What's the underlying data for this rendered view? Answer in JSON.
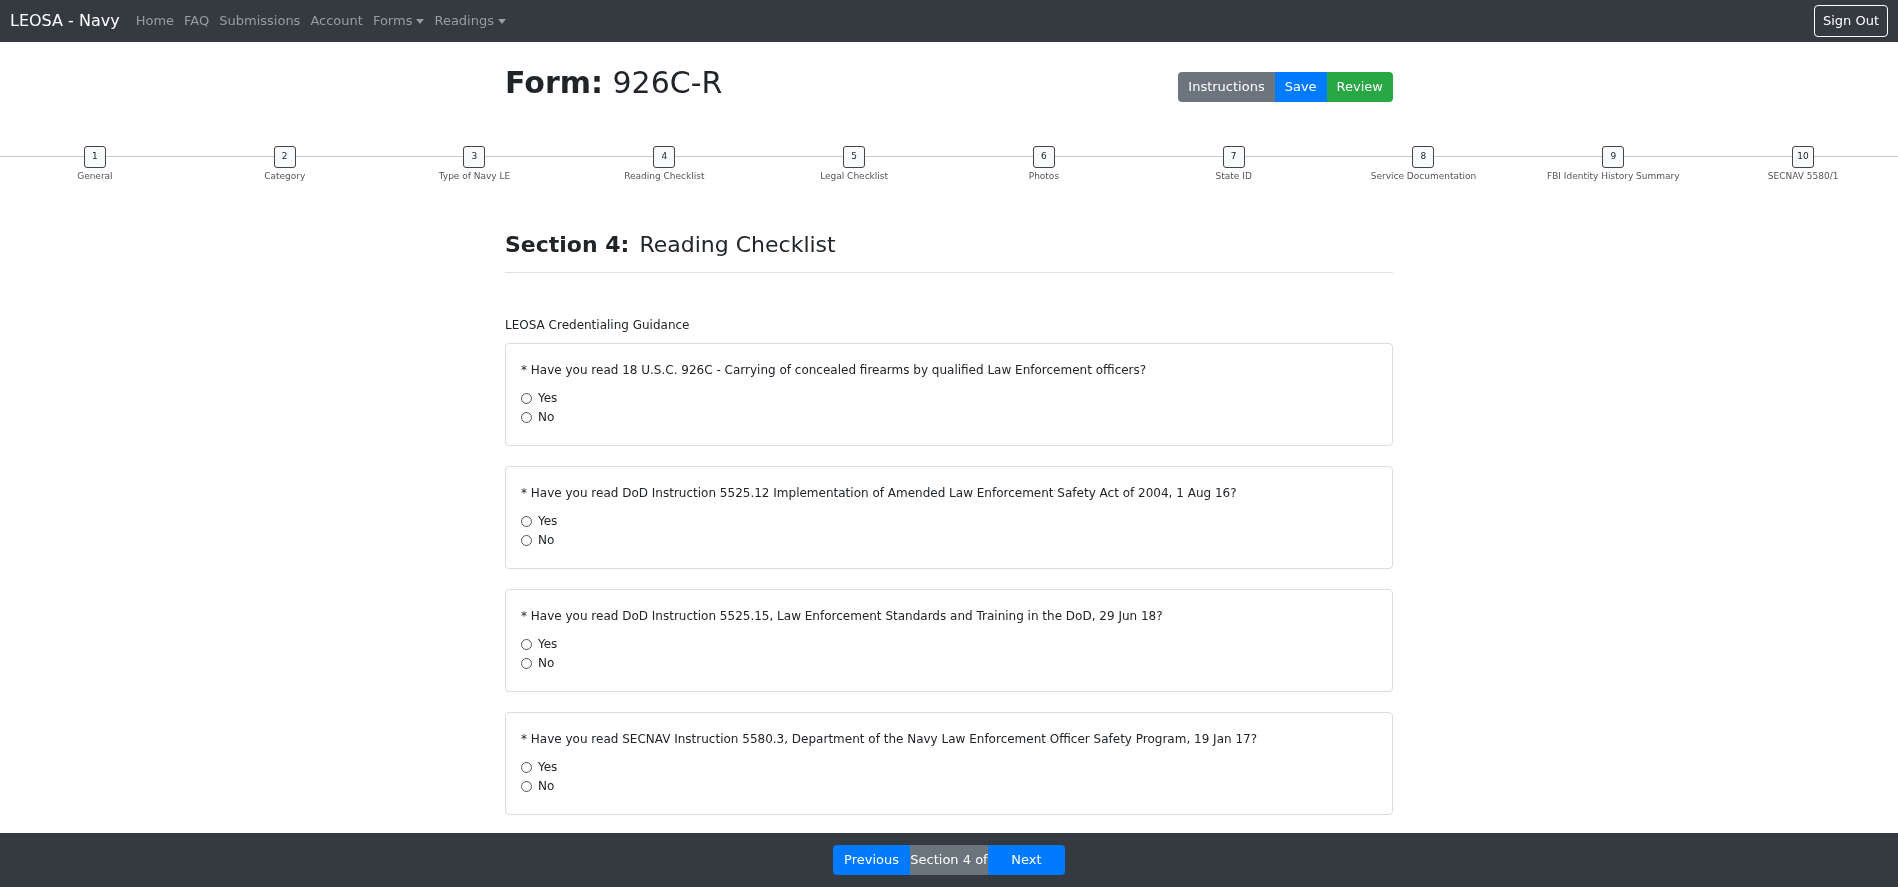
{
  "navbar": {
    "brand": "LEOSA - Navy",
    "links": [
      {
        "label": "Home",
        "dropdown": false
      },
      {
        "label": "FAQ",
        "dropdown": false
      },
      {
        "label": "Submissions",
        "dropdown": false
      },
      {
        "label": "Account",
        "dropdown": false
      },
      {
        "label": "Forms",
        "dropdown": true
      },
      {
        "label": "Readings",
        "dropdown": true
      }
    ],
    "sign_out": "Sign Out"
  },
  "header": {
    "form_label": "Form:",
    "form_name": "926C-R",
    "buttons": [
      {
        "label": "Instructions",
        "kind": "secondary"
      },
      {
        "label": "Save",
        "kind": "primary"
      },
      {
        "label": "Review",
        "kind": "success"
      }
    ]
  },
  "steps": [
    {
      "number": "1",
      "label": "General"
    },
    {
      "number": "2",
      "label": "Category"
    },
    {
      "number": "3",
      "label": "Type of Navy LE"
    },
    {
      "number": "4",
      "label": "Reading Checklist"
    },
    {
      "number": "5",
      "label": "Legal Checklist"
    },
    {
      "number": "6",
      "label": "Photos"
    },
    {
      "number": "7",
      "label": "State ID"
    },
    {
      "number": "8",
      "label": "Service Documentation"
    },
    {
      "number": "9",
      "label": "FBI Identity History Summary"
    },
    {
      "number": "10",
      "label": "SECNAV 5580/1"
    }
  ],
  "section": {
    "label": "Section 4:",
    "title": "Reading Checklist",
    "subtitle": "LEOSA Credentialing Guidance"
  },
  "questions": [
    {
      "text": "* Have you read 18 U.S.C. 926C - Carrying of concealed firearms by qualified Law Enforcement officers?",
      "options": [
        {
          "label": "Yes",
          "selected": false
        },
        {
          "label": "No",
          "selected": false
        }
      ]
    },
    {
      "text": "* Have you read DoD Instruction 5525.12 Implementation of Amended Law Enforcement Safety Act of 2004, 1 Aug 16?",
      "options": [
        {
          "label": "Yes",
          "selected": false
        },
        {
          "label": "No",
          "selected": false
        }
      ]
    },
    {
      "text": "* Have you read DoD Instruction 5525.15, Law Enforcement Standards and Training in the DoD, 29 Jun 18?",
      "options": [
        {
          "label": "Yes",
          "selected": false
        },
        {
          "label": "No",
          "selected": false
        }
      ]
    },
    {
      "text": "* Have you read SECNAV Instruction 5580.3, Department of the Navy Law Enforcement Officer Safety Program, 19 Jan 17?",
      "options": [
        {
          "label": "Yes",
          "selected": false
        },
        {
          "label": "No",
          "selected": false
        }
      ]
    }
  ],
  "footer": {
    "previous": "Previous",
    "section_indicator": "Section 4 of",
    "next": "Next"
  }
}
